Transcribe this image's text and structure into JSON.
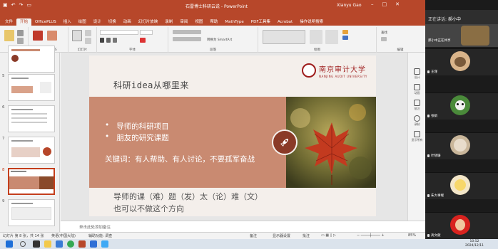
{
  "titlebar": {
    "title": "石雷博士科研云说 - PowerPoint",
    "user": "Xianyu Gao",
    "user_initials": "XG"
  },
  "tabs": [
    "文件",
    "开始",
    "OfficePLUS",
    "插入",
    "绘图",
    "设计",
    "切换",
    "动画",
    "幻灯片放映",
    "录制",
    "审阅",
    "视图",
    "帮助",
    "MathType",
    "PDF工具集",
    "Acrobat",
    "操作说明搜索"
  ],
  "ribbon": {
    "groups": [
      "剪贴板",
      "OfficePLUS",
      "幻灯片",
      "字体",
      "段落",
      "绘图",
      "编辑"
    ],
    "smartart_label": "转换为 SmartArt",
    "find_label": "查找"
  },
  "thumbnails": [
    {
      "num": "5"
    },
    {
      "num": "6"
    },
    {
      "num": "7"
    },
    {
      "num": "8"
    },
    {
      "num": "9"
    }
  ],
  "slide": {
    "title": "科研idea从哪里来",
    "university_cn": "南京审计大学",
    "university_en": "NANJING AUDIT UNIVERSITY",
    "bullets": [
      "导师的科研项目",
      "朋友的研究课题"
    ],
    "keywords": "关键词：有人帮助、有人讨论，不要孤军奋战",
    "bottom_line1": "导师的课（难）题（发）太（论）难（文）",
    "bottom_line2": "也可以不做这个方向"
  },
  "notes_placeholder": "单击此处添加备注",
  "right_tools": [
    "设计",
    "动画",
    "批注",
    "录制",
    "显示所有"
  ],
  "status": {
    "slide_info": "幻灯片 第 8 张，共 14 张",
    "language": "英语(中国大陆)",
    "accessibility": "辅助功能: 调查",
    "notes_btn": "备注",
    "display_btn": "显示器设置",
    "comments_btn": "批注",
    "zoom": "85%"
  },
  "meeting": {
    "speaking_label": "正在讲话:",
    "speaking_name": "郝小中",
    "self_label": "郝小中正在共享",
    "participants": [
      {
        "name": "王瑾"
      },
      {
        "name": "张娟"
      },
      {
        "name": "叶晓珊"
      },
      {
        "name": "朱大事端"
      },
      {
        "name": "高文献"
      }
    ]
  },
  "taskbar": {
    "time": "10:52",
    "date": "2024/12/11"
  },
  "colors": {
    "ppt_accent": "#b7472a",
    "slide_band": "#c98a71",
    "logo_red": "#9e1c1c"
  }
}
